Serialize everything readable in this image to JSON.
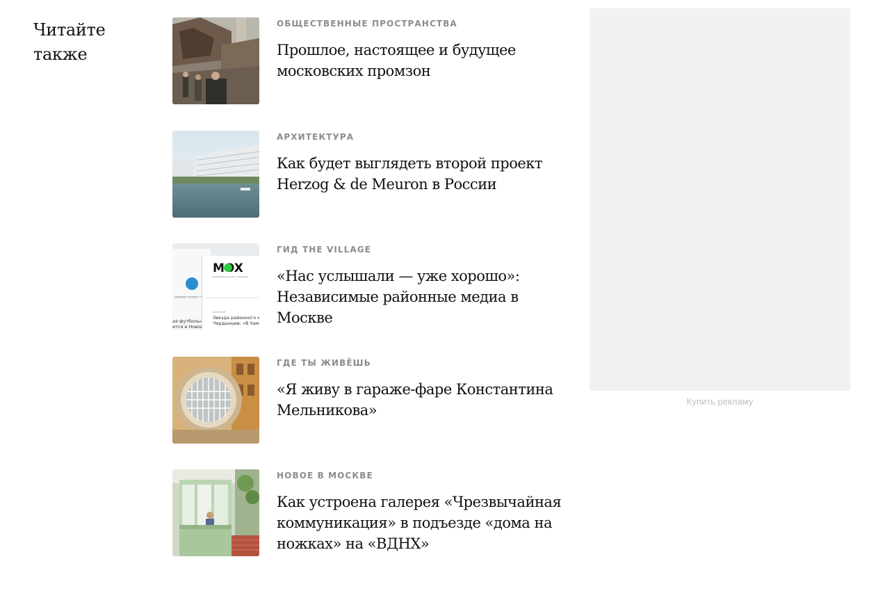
{
  "section": {
    "title": "Читайте также"
  },
  "articles": [
    {
      "rubric": "ОБЩЕСТВЕННЫЕ ПРОСТРАНСТВА",
      "title": "Прошлое, настоящее и будущее московских промзон",
      "image": "industrial-ruins-photo"
    },
    {
      "rubric": "АРХИТЕКТУРА",
      "title": "Как будет выглядеть второй проект Herzog & de Meuron в России",
      "image": "waterfront-building-render"
    },
    {
      "rubric": "ГИД THE VILLAGE",
      "title": "«Нас услышали — уже хорошо»: Независимые районные медиа в Москве",
      "image": "media-screens-collage",
      "image_text": {
        "logo": "MOX",
        "tagline": "Муниципальный округ Хамовники",
        "news_date": "05.03.2019",
        "news_line_1": "Звезда районного м",
        "news_line_2": "Чердынцев: «В Хамо",
        "left_line_1": "ая футбольн",
        "left_line_2": "ится в Новой",
        "left_nav": "ПЕТЕРБУРГ · МОСКВ"
      }
    },
    {
      "rubric": "ГДЕ ТЫ ЖИВЁШЬ",
      "title": "«Я живу в гараже-фаре Константина Мельникова»",
      "image": "round-window-facade-photo"
    },
    {
      "rubric": "НОВОЕ В МОСКВЕ",
      "title": "Как устроена галерея «Чрезвычайная коммуникация» в подъезде «дома на ножках» на «ВДНХ»",
      "image": "green-kiosk-gallery-photo"
    }
  ],
  "ad": {
    "buy_label": "Купить рекламу"
  },
  "colors": {
    "rubric": "#8c8c8c",
    "headline": "#111111",
    "ad_background": "#f1f1f1",
    "ad_link": "#c0c0c0",
    "mox_logo_green": "#2ecc40"
  }
}
